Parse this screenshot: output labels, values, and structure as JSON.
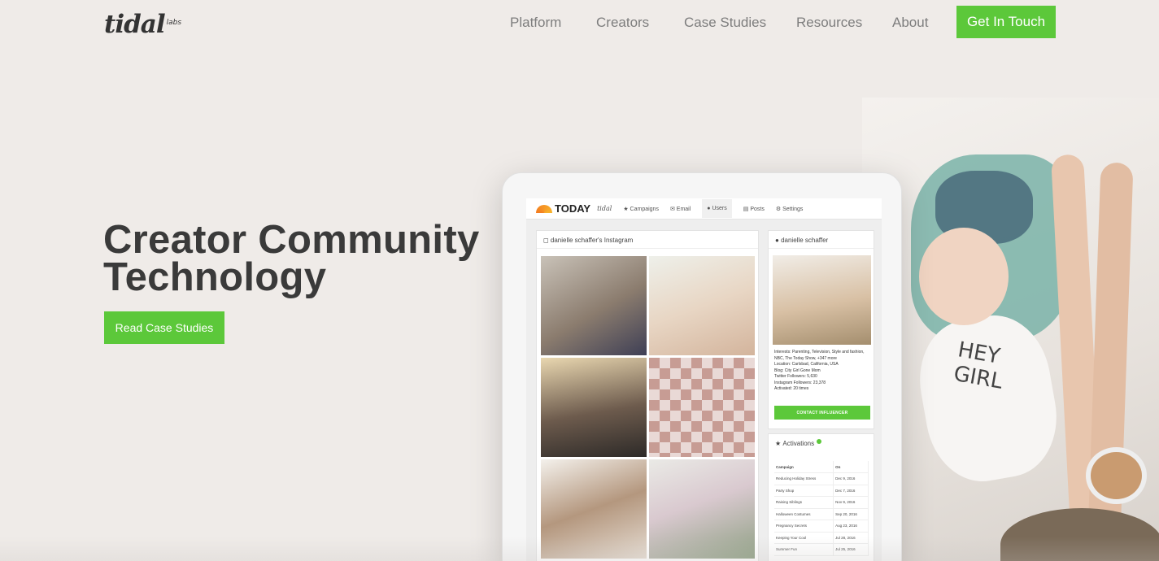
{
  "header": {
    "logo_text": "tidal",
    "logo_sub": "labs",
    "nav": [
      "Platform",
      "Creators",
      "Case Studies",
      "Resources",
      "About"
    ],
    "cta_label": "Get In Touch"
  },
  "hero": {
    "title_line1": "Creator Community",
    "title_line2": "Technology",
    "button_label": "Read Case Studies"
  },
  "tablet": {
    "brand": "TODAY",
    "brand_sub": "tidal",
    "tabs": [
      "Campaigns",
      "Email",
      "Users",
      "Posts",
      "Settings"
    ],
    "instagram_header": "danielle schaffer's Instagram",
    "profile_name": "danielle schaffer",
    "profile_info": [
      "Interests: Parenting, Television, Style and fashion, NBC, The Today Show, +347 more",
      "Location: Carlsbad, California, USA",
      "Blog: City Girl Gone Mom",
      "Twitter Followers: 5,630",
      "Instagram Followers: 23,378",
      "Activated: 20 times"
    ],
    "contact_label": "CONTACT INFLUENCER",
    "activations_title": "Activations",
    "activations_cols": [
      "Campaign",
      "On"
    ],
    "activations_rows": [
      [
        "Reducing Holiday Stress",
        "Dec 9, 2016"
      ],
      [
        "Party Shop",
        "Dec 7, 2016"
      ],
      [
        "Raising Siblings",
        "Nov 9, 2016"
      ],
      [
        "Halloween Costumes",
        "Sep 20, 2016"
      ],
      [
        "Pregnancy Secrets",
        "Aug 23, 2016"
      ],
      [
        "Keeping Your Cool",
        "Jul 28, 2016"
      ],
      [
        "Summer Fun",
        "Jul 25, 2016"
      ]
    ]
  },
  "photo": {
    "shirt_text_line1": "HEY",
    "shirt_text_line2": "GIRL"
  },
  "colors": {
    "accent": "#5cc83a",
    "background": "#efebe8",
    "text": "#3a3a3a",
    "nav_text": "#7d7d7d"
  }
}
